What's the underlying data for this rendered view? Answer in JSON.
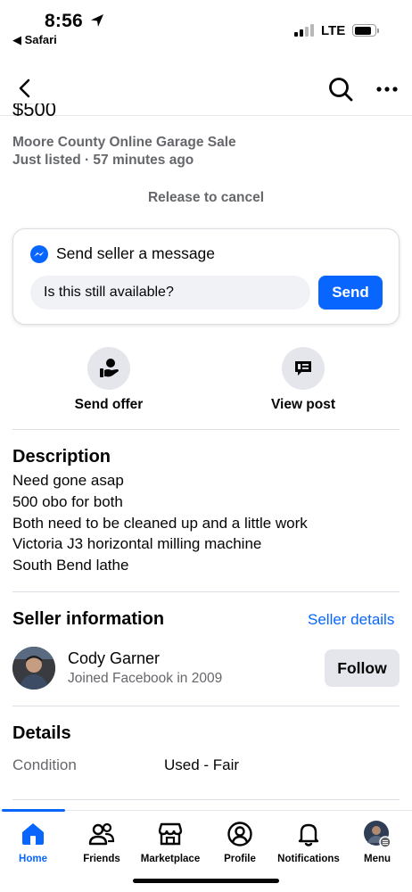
{
  "status_bar": {
    "time": "8:56",
    "back_app": "◀ Safari",
    "network": "LTE"
  },
  "listing": {
    "price": "$500",
    "group": "Moore County Online Garage Sale",
    "listed": "Just listed · 57 minutes ago",
    "release_hint": "Release to cancel"
  },
  "message_card": {
    "title": "Send seller a message",
    "input_value": "Is this still available?",
    "send_label": "Send"
  },
  "actions": {
    "offer_label": "Send offer",
    "view_label": "View post"
  },
  "description": {
    "title": "Description",
    "lines": [
      "Need gone asap",
      "500 obo for both",
      "Both need to be cleaned up and a little work",
      "Victoria J3 horizontal milling machine",
      "South Bend lathe"
    ]
  },
  "seller": {
    "title": "Seller information",
    "details_link": "Seller details",
    "name": "Cody Garner",
    "joined": "Joined Facebook in 2009",
    "follow_label": "Follow"
  },
  "details": {
    "title": "Details",
    "condition_key": "Condition",
    "condition_value": "Used - Fair"
  },
  "tabs": [
    {
      "label": "Home",
      "icon": "home-icon"
    },
    {
      "label": "Friends",
      "icon": "friends-icon"
    },
    {
      "label": "Marketplace",
      "icon": "marketplace-icon"
    },
    {
      "label": "Profile",
      "icon": "profile-icon"
    },
    {
      "label": "Notifications",
      "icon": "bell-icon"
    },
    {
      "label": "Menu",
      "icon": "menu-avatar-icon"
    }
  ],
  "colors": {
    "accent": "#0866ff",
    "secondary_text": "#65676b",
    "button_gray": "#e4e6eb"
  }
}
